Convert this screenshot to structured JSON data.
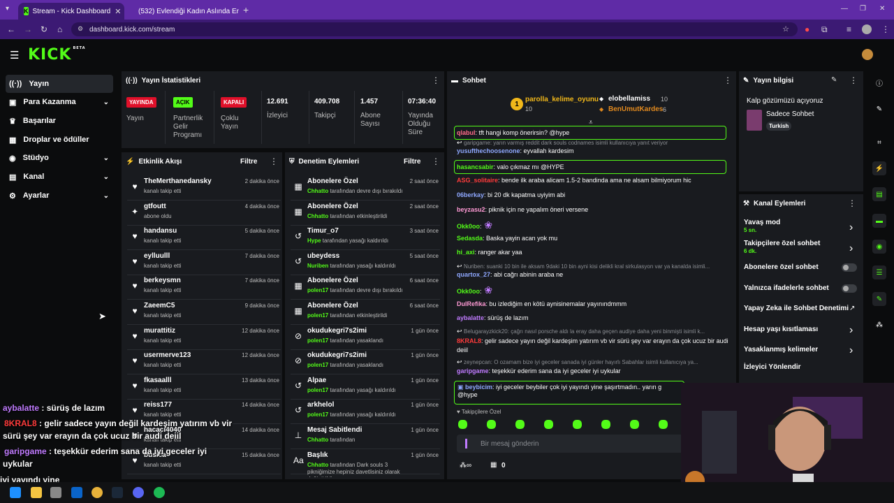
{
  "browser": {
    "tabs": [
      {
        "label": "Stream - Kick Dashboard",
        "active": true
      },
      {
        "label": "(532) Evlendiği Kadın Aslında Er",
        "active": false
      }
    ],
    "url": "dashboard.kick.com/stream"
  },
  "app": {
    "logo": "KICK",
    "beta": "BETA"
  },
  "sidebar": {
    "items": [
      {
        "label": "Yayın",
        "icon": "broadcast-icon",
        "active": true
      },
      {
        "label": "Para Kazanma",
        "icon": "money-icon",
        "chevron": true
      },
      {
        "label": "Başarılar",
        "icon": "trophy-icon"
      },
      {
        "label": "Droplar ve ödüller",
        "icon": "gift-icon"
      },
      {
        "label": "Stüdyo",
        "icon": "studio-icon",
        "chevron": true
      },
      {
        "label": "Kanal",
        "icon": "channel-icon",
        "chevron": true
      },
      {
        "label": "Ayarlar",
        "icon": "gear-icon",
        "chevron": true
      }
    ]
  },
  "stats": {
    "title": "Yayın İstatistikleri",
    "badges": [
      {
        "text": "YAYINDA",
        "label": "Yayın",
        "color": "#e0102a"
      },
      {
        "text": "AÇIK",
        "label": "Partnerlik Gelir Programı",
        "color": "#53fc18"
      },
      {
        "text": "KAPALI",
        "label": "Çoklu Yayın",
        "color": "#e0102a"
      }
    ],
    "numbers": [
      {
        "value": "12.691",
        "label": "İzleyici"
      },
      {
        "value": "409.708",
        "label": "Takipçi"
      },
      {
        "value": "1.457",
        "label": "Abone Sayısı"
      },
      {
        "value": "07:36:40",
        "label": "Yayında Olduğu Süre"
      }
    ]
  },
  "activity": {
    "title": "Etkinlik Akışı",
    "filter": "Filtre",
    "rows": [
      {
        "name": "TheMerthanedansky",
        "sub": "kanalı takip etti",
        "time": "2 dakika önce",
        "icon": "heart-icon"
      },
      {
        "name": "gtfoutt",
        "sub": "abone oldu",
        "time": "4 dakika önce",
        "icon": "star-icon"
      },
      {
        "name": "handansu",
        "sub": "kanalı takip etti",
        "time": "5 dakika önce",
        "icon": "heart-icon"
      },
      {
        "name": "eylluulll",
        "sub": "kanalı takip etti",
        "time": "7 dakika önce",
        "icon": "heart-icon"
      },
      {
        "name": "berkeysmn",
        "sub": "kanalı takip etti",
        "time": "7 dakika önce",
        "icon": "heart-icon"
      },
      {
        "name": "ZaeemC5",
        "sub": "kanalı takip etti",
        "time": "9 dakika önce",
        "icon": "heart-icon"
      },
      {
        "name": "murattitiz",
        "sub": "kanalı takip etti",
        "time": "12 dakika önce",
        "icon": "heart-icon"
      },
      {
        "name": "usermerve123",
        "sub": "kanalı takip etti",
        "time": "12 dakika önce",
        "icon": "heart-icon"
      },
      {
        "name": "fkasaalll",
        "sub": "kanalı takip etti",
        "time": "13 dakika önce",
        "icon": "heart-icon"
      },
      {
        "name": "reiss177",
        "sub": "kanalı takip etti",
        "time": "14 dakika önce",
        "icon": "heart-icon"
      },
      {
        "name": "hacaci4040",
        "sub": "kanalı takip etti",
        "time": "14 dakika önce",
        "icon": "heart-icon"
      },
      {
        "name": "busica",
        "sub": "kanalı takip etti",
        "time": "15 dakika önce",
        "icon": "heart-icon"
      }
    ]
  },
  "moderation": {
    "title": "Denetim Eylemleri",
    "filter": "Filtre",
    "rows": [
      {
        "name": "Abonelere Özel",
        "actor": "Chhatto",
        "sub": "tarafından devre dışı bırakıldı",
        "time": "2 saat önce",
        "icon": "gift-icon"
      },
      {
        "name": "Abonelere Özel",
        "actor": "Chhatto",
        "sub": "tarafından etkinleştirildi",
        "time": "2 saat önce",
        "icon": "gift-icon"
      },
      {
        "name": "Timur_o7",
        "actor": "Hype",
        "sub": "tarafından yasağı kaldırıldı",
        "time": "3 saat önce",
        "icon": "undo-icon"
      },
      {
        "name": "ubeydess",
        "actor": "Nuriben",
        "sub": "tarafından yasağı kaldırıldı",
        "time": "5 saat önce",
        "icon": "undo-icon"
      },
      {
        "name": "Abonelere Özel",
        "actor": "polen17",
        "sub": "tarafından devre dışı bırakıldı",
        "time": "6 saat önce",
        "icon": "gift-icon"
      },
      {
        "name": "Abonelere Özel",
        "actor": "polen17",
        "sub": "tarafından etkinleştirildi",
        "time": "6 saat önce",
        "icon": "gift-icon"
      },
      {
        "name": "okudukegri7s2imi",
        "actor": "polen17",
        "sub": "tarafından yasaklandı",
        "time": "1 gün önce",
        "icon": "ban-icon"
      },
      {
        "name": "okudukegri7s2imi",
        "actor": "polen17",
        "sub": "tarafından yasaklandı",
        "time": "1 gün önce",
        "icon": "ban-icon"
      },
      {
        "name": "Alpae",
        "actor": "polen17",
        "sub": "tarafından yasağı kaldırıldı",
        "time": "1 gün önce",
        "icon": "undo-icon"
      },
      {
        "name": "arkhelol",
        "actor": "polen17",
        "sub": "tarafından yasağı kaldırıldı",
        "time": "1 gün önce",
        "icon": "undo-icon"
      },
      {
        "name": "Mesaj Sabitlendi",
        "actor": "Chhatto",
        "sub": "tarafından",
        "time": "1 gün önce",
        "icon": "pin-icon"
      },
      {
        "name": "Başlık",
        "actor": "Chhatto",
        "sub": "tarafından Dark souls 3 pikniğimize hepiniz davetlisiniz olarak değiştirildi",
        "time": "1 gün önce",
        "icon": "text-icon"
      }
    ]
  },
  "chat": {
    "title": "Sohbet",
    "top_gifters": {
      "first": {
        "rank": "1",
        "name": "parolla_kelime_oyunu",
        "count": "10"
      },
      "second": {
        "name": "elobellamiss",
        "count": "10"
      },
      "third": {
        "name": "BenUmutKardes",
        "count": "6"
      }
    },
    "messages": [
      {
        "user": "qlabul",
        "color": "#ff6b8a",
        "text": ": tft hangi komp önerirsin? @hype",
        "highlight": true
      },
      {
        "reply": "garipgame: yarın varmış reddit dark souls codnames isimli kullanıcıya yanıt veriyor"
      },
      {
        "user": "yusufthechoosenone",
        "color": "#8fa8ff",
        "text": ": eyvallah kardesim"
      },
      {
        "user": "hasancsabir",
        "color": "#53fc18",
        "text": ": valo çıkmaz mı @HYPE",
        "highlight": true
      },
      {
        "user": "ASG_solitaire",
        "color": "#ff3b3b",
        "text": ": bende ilk araba alicam 1.5-2 bandinda ama ne alsam bilmiyorum hic"
      },
      {
        "user": "06berkay",
        "color": "#8fa8ff",
        "text": ": bi 20 dk kapatma uyiyim abi"
      },
      {
        "user": "beyzasu2",
        "color": "#ff9ad5",
        "text": ": piknik için ne yapalım öneri versene"
      },
      {
        "user": "Okk0oo",
        "color": "#53fc18",
        "text": ":",
        "emote": true
      },
      {
        "user": "Sedasda",
        "color": "#53fc18",
        "text": ": Baska yayin acan yok mu"
      },
      {
        "user": "hi_axi",
        "color": "#53fc18",
        "text": ": ranger akar yaa"
      },
      {
        "reply": "Nuriben: suanki 10 bin ile aksam 9daki 10 bin ayni kisi delikli kral sirkulasyon var ya kanalda isimli..."
      },
      {
        "user": "quartox_27",
        "color": "#8fa8ff",
        "text": ": abi cağrı abinin araba ne"
      },
      {
        "user": "Okk0oo",
        "color": "#53fc18",
        "text": ":",
        "emote": true
      },
      {
        "user": "DulRefika",
        "color": "#ff9ad5",
        "text": ": bu izlediğim en kötü aynisinemalar yayınındmmm"
      },
      {
        "user": "aybalatte",
        "color": "#c07bff",
        "text": ": sürüş de lazım"
      },
      {
        "reply": "Belugarayzkick20: çağrı nasıl porsche aldı la eray daha geçen audiye daha yeni binmişti isimli k..."
      },
      {
        "user": "8KRAL8",
        "color": "#ff3b3b",
        "text": ": gelir sadece yayın değil kardeşim yatırım vb vir sürü şey var erayın da çok ucuz bir audi deiil"
      },
      {
        "reply": "zeynepcan: O ozamam bize iyi geceler sanada iyi günler hayırlı Sabahlar isimli kullanıcıya ya..."
      },
      {
        "user": "garipgame",
        "color": "#c07bff",
        "text": ": teşekkür ederim sana da iyi geceler iyi uykular"
      }
    ],
    "pinned": {
      "user": "beybicim",
      "text": ": iyi geceler beybiler  çok iyi yayındı yine şaşırtmadın.. yarın g",
      "text2": "@hype"
    },
    "followers_label": "Takipçilere Özel",
    "input_placeholder": "Bir mesaj gönderin",
    "footer_count": "0"
  },
  "stream_info": {
    "title": "Yayın bilgisi",
    "stream_title": "Kalp gözümüzü açıyoruz",
    "category": "Sadece Sohbet",
    "tag": "Turkish"
  },
  "channel_actions": {
    "title": "Kanal Eylemleri",
    "items": [
      {
        "label": "Yavaş mod",
        "value": "5 sn.",
        "type": "chevron"
      },
      {
        "label": "Takipçilere özel sohbet",
        "value": "6 dk.",
        "type": "chevron"
      },
      {
        "label": "Abonelere özel sohbet",
        "type": "toggle"
      },
      {
        "label": "Yalnızca ifadelerle sohbet",
        "type": "toggle"
      },
      {
        "label": "Yapay Zeka ile Sohbet Denetimi",
        "type": "external"
      },
      {
        "label": "Hesap yaşı kısıtlaması",
        "type": "chevron"
      },
      {
        "label": "Yasaklanmış kelimeler",
        "type": "chevron"
      },
      {
        "label": "İzleyici Yönlendir",
        "type": "none"
      }
    ]
  },
  "overlay": {
    "lines": [
      {
        "user": "aybalatte",
        "color": "#c07bff",
        "text": " : sürüş de lazım"
      },
      {
        "user": "8KRAL8",
        "color": "#ff3b3b",
        "text": " : gelir sadece yayın değil kardeşim yatırım vb vir"
      },
      {
        "user": "",
        "color": "#ffffff",
        "text": "sürü şey var erayın da çok ucuz bir audi deiil"
      },
      {
        "user": "garipgame",
        "color": "#c07bff",
        "text": " : teşekkür ederim sana da iyi geceler iyi"
      },
      {
        "user": "",
        "color": "#ffffff",
        "text": "uykular"
      },
      {
        "user": "",
        "color": "#ffffff",
        "text": "iyi yayındı yine"
      }
    ]
  },
  "colors": {
    "accent": "#53fc18",
    "live": "#e0102a",
    "browser": "#5f2ba6"
  }
}
